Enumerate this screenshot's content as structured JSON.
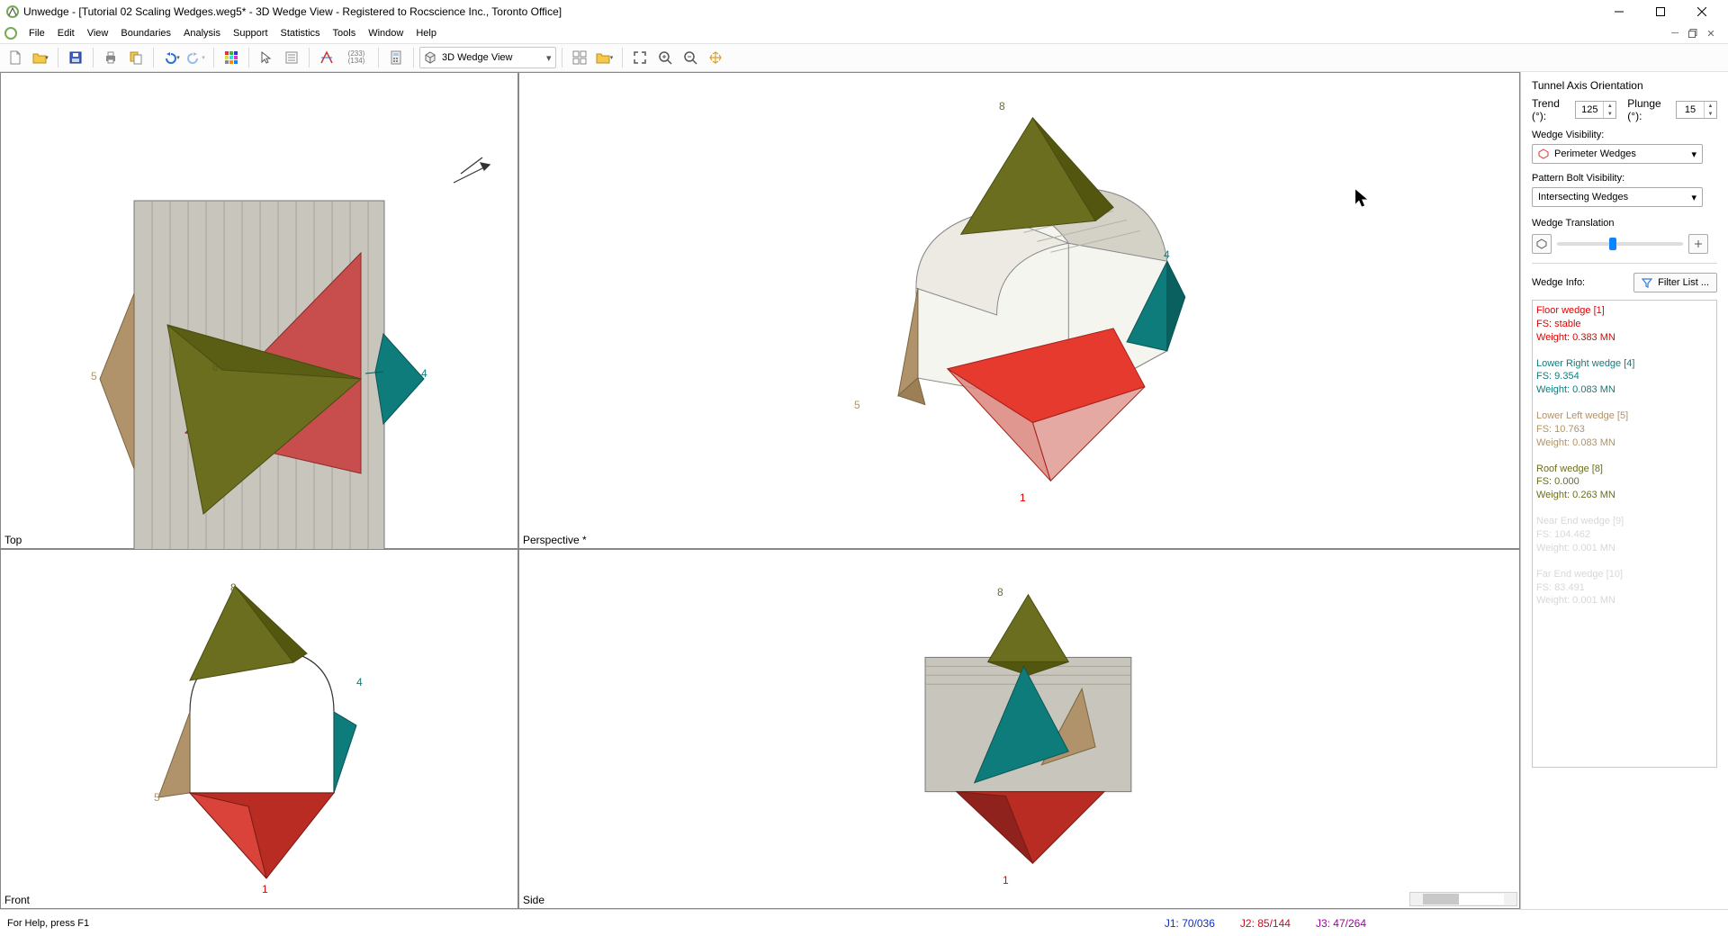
{
  "window": {
    "title": "Unwedge - [Tutorial 02 Scaling Wedges.weg5* - 3D Wedge View - Registered to Rocscience Inc., Toronto Office]"
  },
  "menu": {
    "items": [
      "File",
      "Edit",
      "View",
      "Boundaries",
      "Analysis",
      "Support",
      "Statistics",
      "Tools",
      "Window",
      "Help"
    ]
  },
  "toolbar": {
    "view_selector_label": "3D Wedge View"
  },
  "panes": {
    "top": "Top",
    "perspective": "Perspective *",
    "front": "Front",
    "side": "Side"
  },
  "labels": {
    "w1": "1",
    "w4": "4",
    "w5": "5",
    "w8": "8"
  },
  "side_panel": {
    "axis_title": "Tunnel Axis Orientation",
    "trend_label": "Trend (°):",
    "trend_value": "125",
    "plunge_label": "Plunge (°):",
    "plunge_value": "15",
    "wedge_vis_label": "Wedge Visibility:",
    "wedge_vis_value": "Perimeter Wedges",
    "bolt_vis_label": "Pattern Bolt Visibility:",
    "bolt_vis_value": "Intersecting Wedges",
    "translation_label": "Wedge Translation",
    "wedge_info_label": "Wedge Info:",
    "filter_btn": "Filter List ..."
  },
  "wedges": [
    {
      "color": "#e30000",
      "name": "Floor wedge [1]",
      "fs": "FS: stable",
      "wt": "Weight: 0.383 MN"
    },
    {
      "color": "#0f7c7c",
      "name": "Lower Right wedge [4]",
      "fs": "FS: 9.354",
      "wt": "Weight: 0.083 MN"
    },
    {
      "color": "#b0936a",
      "name": "Lower Left wedge [5]",
      "fs": "FS: 10.763",
      "wt": "Weight: 0.083 MN"
    },
    {
      "color": "#6b6e1e",
      "name": "Roof wedge [8]",
      "fs": "FS: 0.000",
      "wt": "Weight: 0.263 MN"
    },
    {
      "color": "#d8d8d8",
      "name": "Near End wedge [9]",
      "fs": "FS: 104.462",
      "wt": "Weight: 0.001 MN"
    },
    {
      "color": "#d8d8d8",
      "name": "Far End wedge [10]",
      "fs": "FS: 83.491",
      "wt": "Weight: 0.001 MN"
    }
  ],
  "status": {
    "help": "For Help, press F1",
    "j1": "J1: 70/036",
    "j2": "J2: 85/144",
    "j3": "J3: 47/264"
  }
}
